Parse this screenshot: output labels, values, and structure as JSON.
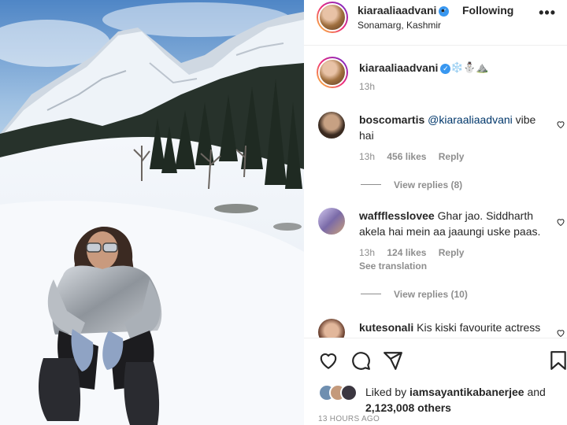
{
  "post": {
    "username": "kiaraaliaadvani",
    "follow_separator": "•",
    "follow_status": "Following",
    "location": "Sonamarg, Kashmir",
    "more_glyph": "•••",
    "verified_glyph": "✓"
  },
  "caption": {
    "username": "kiaraaliaadvani",
    "emojis": "❄️⛄⛰️",
    "time": "13h"
  },
  "comments": [
    {
      "username": "boscomartis",
      "mention": "@kiaraaliaadvani",
      "text": " vibe hai",
      "time": "13h",
      "likes": "456 likes",
      "reply": "Reply",
      "view_replies": "View replies (8)"
    },
    {
      "username": "waffflesslovee",
      "text": " Ghar jao. Siddharth akela hai mein aa jaaungi uske paas.",
      "time": "13h",
      "likes": "124 likes",
      "reply": "Reply",
      "see_translation": "See translation",
      "view_replies": "View replies (10)"
    },
    {
      "username": "kutesonali",
      "text": " Kis kiski favourite actress"
    }
  ],
  "likes": {
    "prefix": "Liked by ",
    "user": "iamsayantikabanerjee",
    "middle": " and ",
    "count": "2,123,008 others"
  },
  "timestamp": "13 HOURS AGO",
  "icons": [
    "heart-icon",
    "comment-icon",
    "share-icon",
    "save-icon",
    "more-icon",
    "verified-icon"
  ],
  "colors": {
    "verified": "#3897f0",
    "muted": "#8e8e8e",
    "mention": "#00376b"
  }
}
